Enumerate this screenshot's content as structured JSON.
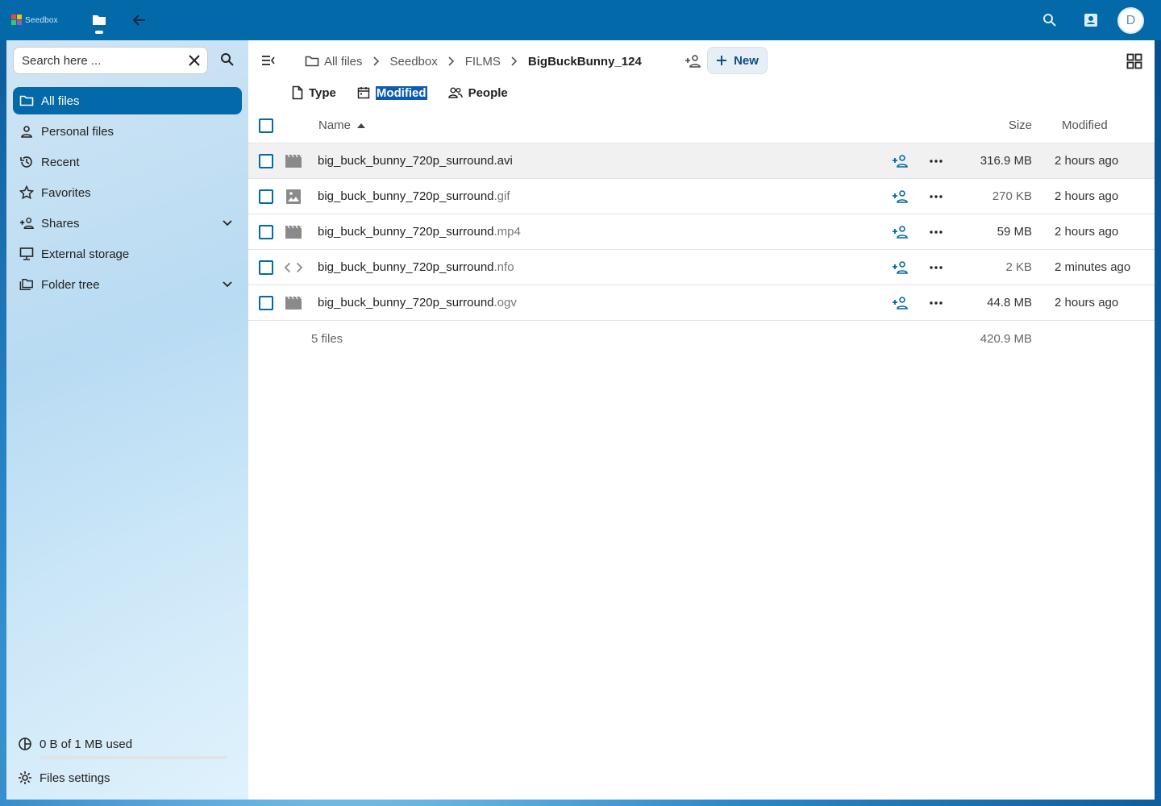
{
  "header": {
    "logo_text": "Seedbox",
    "avatar_initial": "D"
  },
  "sidebar": {
    "search_placeholder": "Search here ...",
    "items": [
      {
        "label": "All files",
        "icon": "folder-icon",
        "active": true
      },
      {
        "label": "Personal files",
        "icon": "person-icon"
      },
      {
        "label": "Recent",
        "icon": "history-icon"
      },
      {
        "label": "Favorites",
        "icon": "star-icon"
      },
      {
        "label": "Shares",
        "icon": "share-person-icon",
        "expandable": true
      },
      {
        "label": "External storage",
        "icon": "monitor-icon"
      },
      {
        "label": "Folder tree",
        "icon": "folder-tree-icon",
        "expandable": true
      }
    ],
    "quota_label": "0 B of 1 MB used",
    "quota_fraction": 0.0,
    "settings_label": "Files settings"
  },
  "breadcrumb": {
    "items": [
      "All files",
      "Seedbox",
      "FILMS",
      "BigBuckBunny_124"
    ]
  },
  "toolbar": {
    "new_label": "New"
  },
  "filters": {
    "type": "Type",
    "modified": "Modified",
    "people": "People"
  },
  "table": {
    "col_name": "Name",
    "col_size": "Size",
    "col_modified": "Modified",
    "rows": [
      {
        "base": "big_buck_bunny_720p_surround",
        "ext": ".avi",
        "icon": "video-icon",
        "size": "316.9 MB",
        "modified": "2 hours ago"
      },
      {
        "base": "big_buck_bunny_720p_surround",
        "ext": ".gif",
        "icon": "image-icon",
        "size": "270 KB",
        "modified": "2 hours ago"
      },
      {
        "base": "big_buck_bunny_720p_surround",
        "ext": ".mp4",
        "icon": "video-icon",
        "size": "59 MB",
        "modified": "2 hours ago"
      },
      {
        "base": "big_buck_bunny_720p_surround",
        "ext": ".nfo",
        "icon": "code-icon",
        "size": "2 KB",
        "modified": "2 minutes ago"
      },
      {
        "base": "big_buck_bunny_720p_surround",
        "ext": ".ogv",
        "icon": "video-icon",
        "size": "44.8 MB",
        "modified": "2 hours ago"
      }
    ],
    "summary_count": "5 files",
    "summary_size": "420.9 MB"
  },
  "colors": {
    "primary": "#0369a8",
    "header": "#0369a8"
  }
}
